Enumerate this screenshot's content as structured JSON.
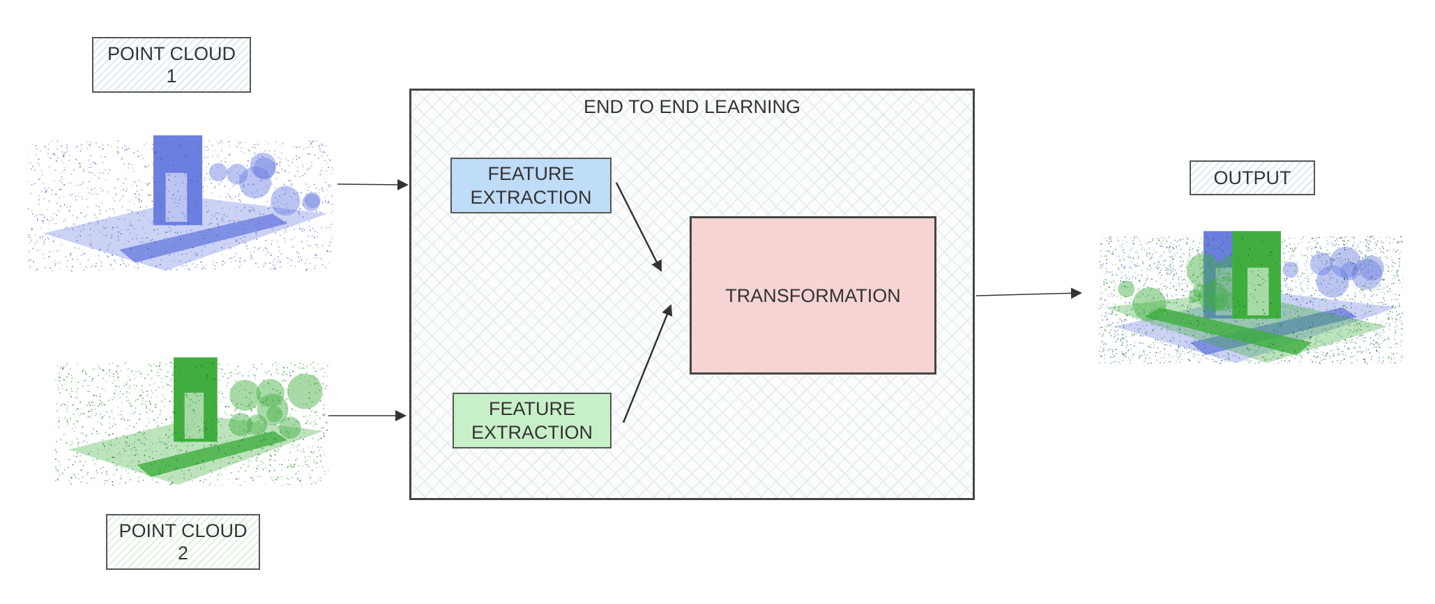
{
  "inputs": [
    {
      "label_line1": "POINT CLOUD",
      "label_line2": "1",
      "cloud_color": "#6b7fe0"
    },
    {
      "label_line1": "POINT CLOUD",
      "label_line2": "2",
      "cloud_color": "#3fae3f"
    }
  ],
  "pipeline": {
    "title": "END TO END LEARNING",
    "feature_extraction_1": {
      "line1": "FEATURE",
      "line2": "EXTRACTION",
      "color": "#bfdcf8"
    },
    "feature_extraction_2": {
      "line1": "FEATURE",
      "line2": "EXTRACTION",
      "color": "#c8f0c8"
    },
    "transformation": {
      "label": "TRANSFORMATION",
      "color": "#f6d4d4"
    }
  },
  "output": {
    "label": "OUTPUT"
  }
}
